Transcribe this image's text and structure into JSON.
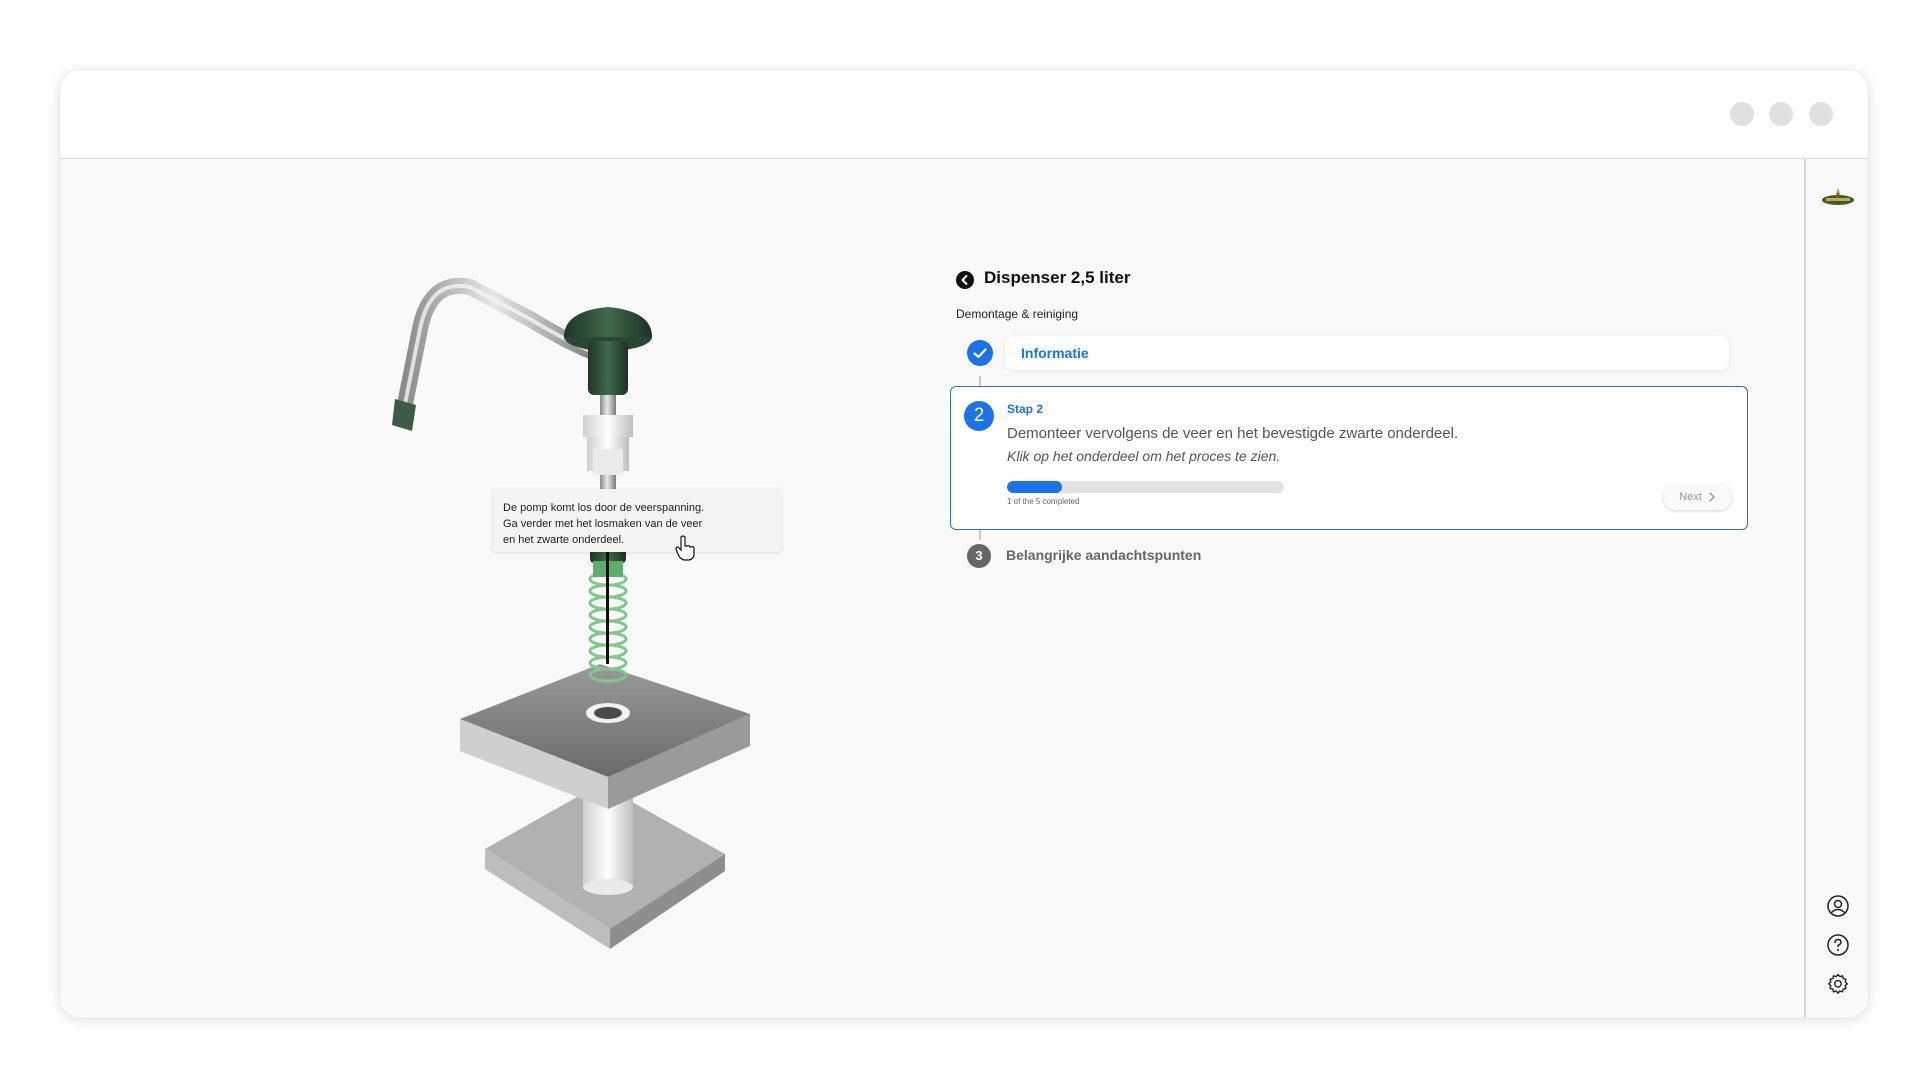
{
  "header": {
    "title": "Dispenser 2,5 liter",
    "subtitle": "Demontage & reiniging"
  },
  "viewport": {
    "tooltip_lines": [
      "De pomp komt los door de veerspanning.",
      "Ga verder met het losmaken van de veer",
      "en het zwarte onderdeel."
    ]
  },
  "steps": [
    {
      "number": "1",
      "label": "Informatie",
      "status": "completed"
    },
    {
      "number": "2",
      "label": "Stap 2",
      "status": "active",
      "description": "Demonteer vervolgens de veer en het bevestigde zwarte onderdeel.",
      "hint": "Klik op het onderdeel om het proces te zien.",
      "progress_value": 1,
      "progress_total": 5,
      "progress_text": "1 of the 5 completed",
      "next_label": "Next"
    },
    {
      "number": "3",
      "label": "Belangrijke aandachtspunten",
      "status": "pending"
    }
  ],
  "sidebar": {
    "icons": [
      "user-icon",
      "help-icon",
      "settings-icon"
    ]
  },
  "colors": {
    "accent": "#1a73e8",
    "model_green": "#2e4a37",
    "spring_green": "#7fc98a"
  }
}
